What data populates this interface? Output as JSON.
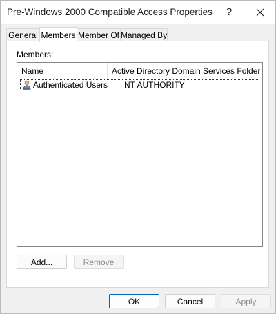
{
  "window": {
    "title": "Pre-Windows 2000 Compatible Access Properties",
    "help_glyph": "?",
    "close_icon": "close-icon"
  },
  "tabs": [
    {
      "label": "General"
    },
    {
      "label": "Members",
      "active": true
    },
    {
      "label": "Member Of"
    },
    {
      "label": "Managed By"
    }
  ],
  "members": {
    "label": "Members:",
    "columns": [
      "Name",
      "Active Directory Domain Services Folder"
    ],
    "rows": [
      {
        "name": "Authenticated Users",
        "folder": "NT AUTHORITY",
        "icon": "user-icon"
      }
    ],
    "add_label": "Add...",
    "remove_label": "Remove"
  },
  "footer": {
    "ok_label": "OK",
    "cancel_label": "Cancel",
    "apply_label": "Apply"
  },
  "colors": {
    "default_button_border": "#0067c0",
    "disabled_text": "#8c8c8c"
  }
}
